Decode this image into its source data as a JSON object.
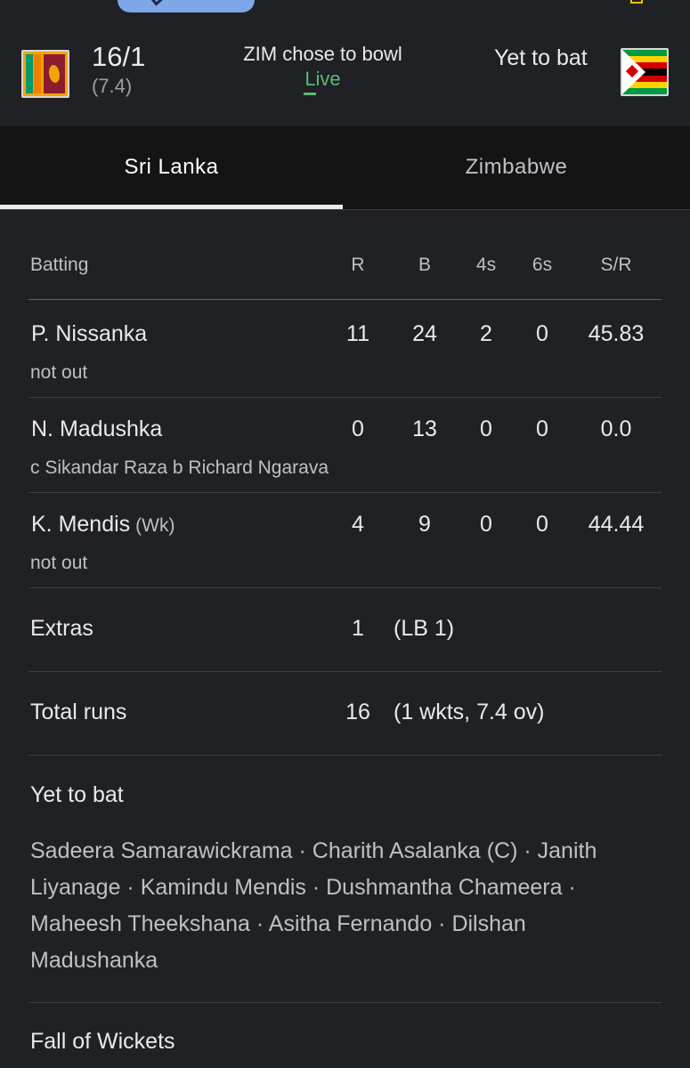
{
  "header": {
    "batting_score": "16/1",
    "batting_overs": "(7.4)",
    "toss": "ZIM chose to bowl",
    "status": "Live",
    "other_status": "Yet to bat"
  },
  "tabs": [
    {
      "label": "Sri Lanka",
      "active": true
    },
    {
      "label": "Zimbabwe",
      "active": false
    }
  ],
  "batting": {
    "columns": [
      "Batting",
      "R",
      "B",
      "4s",
      "6s",
      "S/R"
    ],
    "rows": [
      {
        "name": "P. Nissanka",
        "tag": "",
        "dismissal": "not out",
        "r": "11",
        "b": "24",
        "fours": "2",
        "sixes": "0",
        "sr": "45.83"
      },
      {
        "name": "N. Madushka",
        "tag": "",
        "dismissal": "c Sikandar Raza b Richard Ngarava",
        "r": "0",
        "b": "13",
        "fours": "0",
        "sixes": "0",
        "sr": "0.0"
      },
      {
        "name": "K. Mendis",
        "tag": "(Wk)",
        "dismissal": "not out",
        "r": "4",
        "b": "9",
        "fours": "0",
        "sixes": "0",
        "sr": "44.44"
      }
    ],
    "extras": {
      "label": "Extras",
      "value": "1",
      "detail": "(LB 1)"
    },
    "total": {
      "label": "Total runs",
      "value": "16",
      "detail": "(1 wkts, 7.4 ov)"
    }
  },
  "yet_to_bat": {
    "title": "Yet to bat",
    "players": "Sadeera Samarawickrama · Charith Asalanka (C) · Janith Liyanage · Kamindu Mendis · Dushmantha Chameera · Maheesh Theekshana · Asitha Fernando · Dilshan Madushanka"
  },
  "fall_of_wickets": {
    "title": "Fall of Wickets"
  },
  "colors": {
    "background": "#202124",
    "tab_bar": "#141414",
    "live": "#5bb974",
    "text": "#e8eaed",
    "muted": "#bdc1c6"
  }
}
